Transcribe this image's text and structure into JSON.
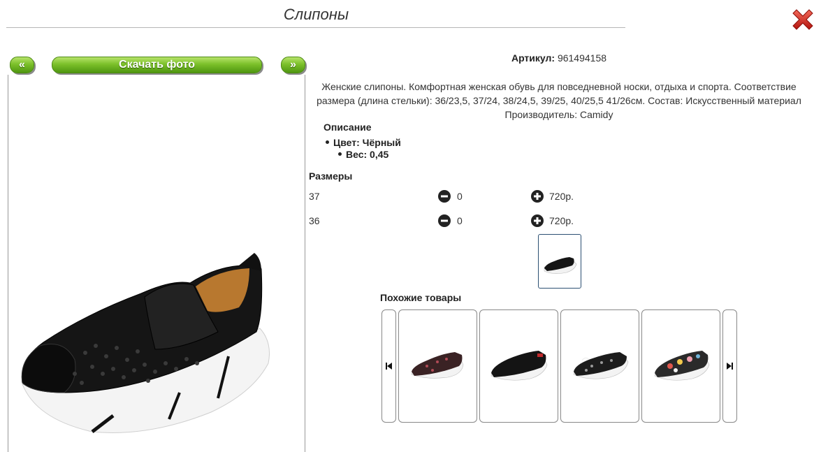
{
  "header": {
    "title": "Слипоны"
  },
  "buttons": {
    "prev": "«",
    "next": "»",
    "download": "Скачать фото"
  },
  "product": {
    "sku_label": "Артикул:",
    "sku_value": "961494158",
    "description_lines": [
      "Женские слипоны. Комфортная женская обувь для повседневной носки, отдыха и спорта. Соответствие",
      "размера (длина стельки): 36/23,5, 37/24, 38/24,5, 39/25, 40/25,5 41/26см. Состав: Искусственный материал",
      "Производитель: Camidy"
    ],
    "spec_title": "Описание",
    "specs": [
      "Цвет: Чёрный",
      "Вес: 0,45"
    ]
  },
  "sizes": {
    "title": "Размеры",
    "rows": [
      {
        "size": "37",
        "qty": "0",
        "price": "720р."
      },
      {
        "size": "36",
        "qty": "0",
        "price": "720р."
      }
    ]
  },
  "similar": {
    "title": "Похожие товары"
  },
  "colors": {
    "accent_green": "#7cc02a",
    "close_red": "#d9231c",
    "thumb_border": "#2b4f72"
  },
  "icons": [
    "close-icon",
    "minus-circle-icon",
    "plus-circle-icon",
    "skip-prev-icon",
    "skip-next-icon"
  ]
}
